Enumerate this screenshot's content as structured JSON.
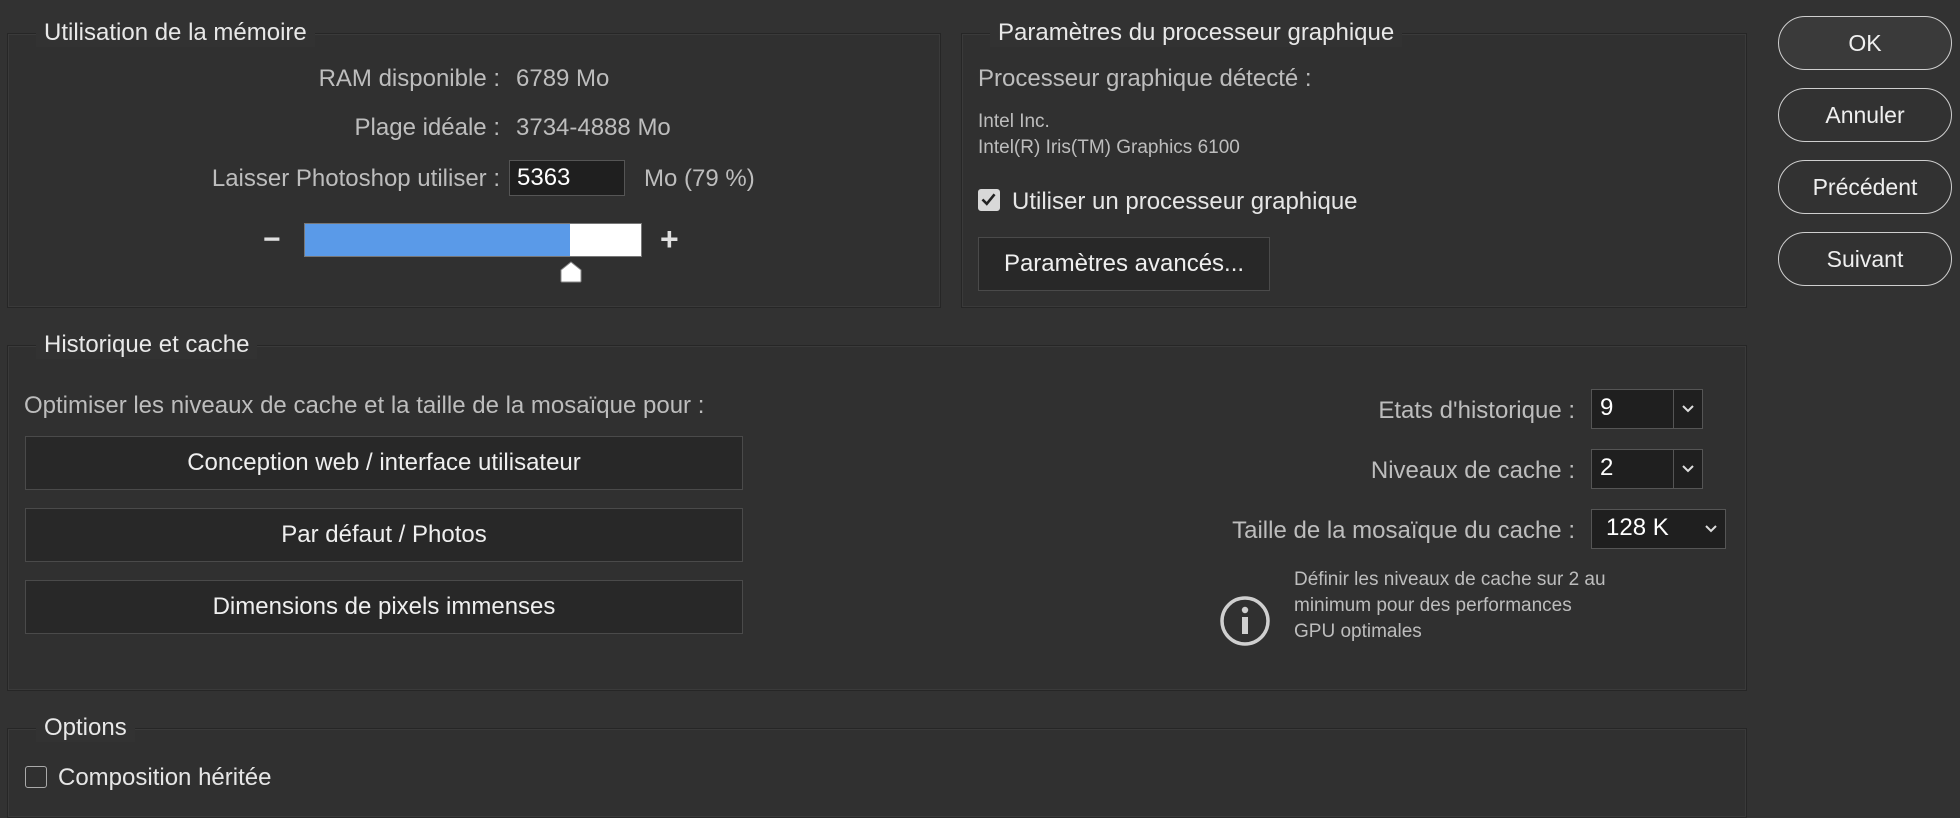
{
  "buttons": {
    "ok": "OK",
    "cancel": "Annuler",
    "previous": "Précédent",
    "next": "Suivant"
  },
  "memory": {
    "title": "Utilisation de la mémoire",
    "ram_label": "RAM disponible :",
    "ram_value": "6789 Mo",
    "ideal_label": "Plage idéale :",
    "ideal_value": "3734-4888 Mo",
    "allow_label": "Laisser Photoshop utiliser :",
    "allow_value": "5363",
    "allow_suffix": "Mo (79 %)",
    "minus": "−",
    "plus": "+",
    "slider_percent": 79
  },
  "gpu": {
    "title": "Paramètres du processeur graphique",
    "detected_label": "Processeur graphique détecté :",
    "vendor": "Intel Inc.",
    "model": "Intel(R) Iris(TM) Graphics 6100",
    "use_gpu_label": "Utiliser un processeur graphique",
    "use_gpu_checked": true,
    "advanced_button": "Paramètres avancés..."
  },
  "history": {
    "title": "Historique et cache",
    "optimize_label": "Optimiser les niveaux de cache et la taille de la mosaïque pour :",
    "preset_web": "Conception web / interface utilisateur",
    "preset_default": "Par défaut / Photos",
    "preset_huge": "Dimensions de pixels immenses",
    "states_label": "Etats d'historique :",
    "states_value": "9",
    "cache_levels_label": "Niveaux de cache :",
    "cache_levels_value": "2",
    "tile_size_label": "Taille de la mosaïque du cache :",
    "tile_size_value": "128 K",
    "info_line1": "Définir les niveaux de cache sur 2 au",
    "info_line2": "minimum pour des performances",
    "info_line3": "GPU optimales"
  },
  "options": {
    "title": "Options",
    "legacy_label": "Composition héritée",
    "legacy_checked": false
  },
  "icons": {
    "info": "info-icon",
    "check": "check-icon",
    "chevron": "chevron-down-icon",
    "thumb": "slider-thumb-icon"
  },
  "colors": {
    "background": "#323232",
    "slider_fill": "#5a9ae8"
  }
}
